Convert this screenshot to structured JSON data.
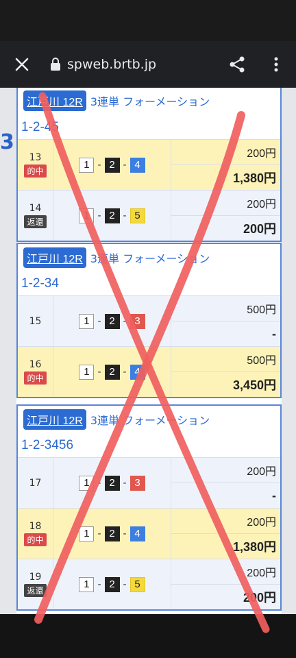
{
  "browser": {
    "url": "spweb.brtb.jp"
  },
  "background_text": "3",
  "cards": [
    {
      "venue": "江戸川 12R",
      "bet_type": "3連単 フォーメーション",
      "combo": "1-2-45",
      "rows": [
        {
          "no": "13",
          "tag": "的中",
          "tag_type": "hit",
          "picks": [
            "1",
            "2",
            "4"
          ],
          "stake": "200円",
          "payout": "1,380円"
        },
        {
          "no": "14",
          "tag": "返還",
          "tag_type": "refund",
          "picks": [
            "1",
            "2",
            "5"
          ],
          "stake": "200円",
          "payout": "200円"
        }
      ]
    },
    {
      "venue": "江戸川 12R",
      "bet_type": "3連単 フォーメーション",
      "combo": "1-2-34",
      "rows": [
        {
          "no": "15",
          "tag": "",
          "tag_type": "",
          "picks": [
            "1",
            "2",
            "3"
          ],
          "stake": "500円",
          "payout": "-"
        },
        {
          "no": "16",
          "tag": "的中",
          "tag_type": "hit",
          "picks": [
            "1",
            "2",
            "4"
          ],
          "stake": "500円",
          "payout": "3,450円"
        }
      ]
    },
    {
      "venue": "江戸川 12R",
      "bet_type": "3連単 フォーメーション",
      "combo": "1-2-3456",
      "rows": [
        {
          "no": "17",
          "tag": "",
          "tag_type": "",
          "picks": [
            "1",
            "2",
            "3"
          ],
          "stake": "200円",
          "payout": "-"
        },
        {
          "no": "18",
          "tag": "的中",
          "tag_type": "hit",
          "picks": [
            "1",
            "2",
            "4"
          ],
          "stake": "200円",
          "payout": "1,380円"
        },
        {
          "no": "19",
          "tag": "返還",
          "tag_type": "refund",
          "picks": [
            "1",
            "2",
            "5"
          ],
          "stake": "200円",
          "payout": "200円"
        }
      ]
    }
  ],
  "colors": {
    "accent": "#2b6bd2",
    "hit_row": "#fdf3b8",
    "normal_row": "#eef3fb",
    "cross_mark": "#f0605e"
  }
}
